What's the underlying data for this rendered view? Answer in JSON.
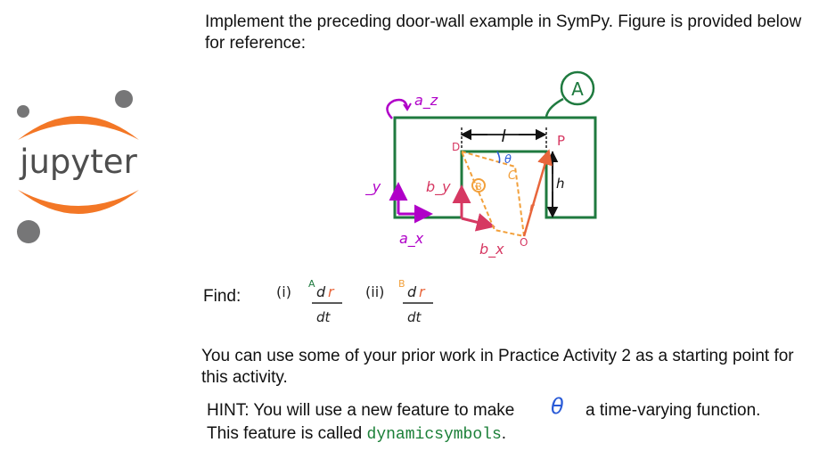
{
  "instructions": {
    "intro": "Implement the preceding door-wall example in SymPy. Figure is provided below for reference:",
    "find_label": "Find:",
    "prior_work": "You can use some of your prior work in Practice Activity 2 as a starting point for this activity.",
    "hint_before": "HINT: You will use a new feature to make",
    "hint_after": "a time-varying function.",
    "hint_line2_prefix": "This feature is called ",
    "hint_code": "dynamicsymbols",
    "hint_line2_suffix": "."
  },
  "logo": {
    "name": "jupyter",
    "colors": {
      "arc": "#f37726",
      "dots": "#767677",
      "text": "#4e4e4e"
    }
  },
  "figure": {
    "frame_a_label": "A",
    "frame_b_label": "B",
    "axis_labels": {
      "az": "a_z",
      "ay": "a_y",
      "ax": "a_x",
      "by": "b_y",
      "bx": "b_x"
    },
    "points": {
      "P": "P",
      "O": "O",
      "C": "C",
      "D": "D"
    },
    "dims": {
      "l": "l",
      "h": "h",
      "theta": "θ",
      "r": "r"
    },
    "colors": {
      "wall": "#1f7a3f",
      "frame_a": "#b000c8",
      "frame_b": "#d63862",
      "door": "#f2a03b",
      "vector": "#e8663c",
      "theta": "#2a5bd7"
    }
  },
  "find_expressions": {
    "item1": {
      "prefix": "(i)",
      "frame": "A",
      "numerator": "d",
      "var": "r",
      "denominator": "dt"
    },
    "item2": {
      "prefix": "(ii)",
      "frame": "B",
      "numerator": "d",
      "var": "r",
      "denominator": "dt"
    }
  },
  "hint_symbol": "θ"
}
